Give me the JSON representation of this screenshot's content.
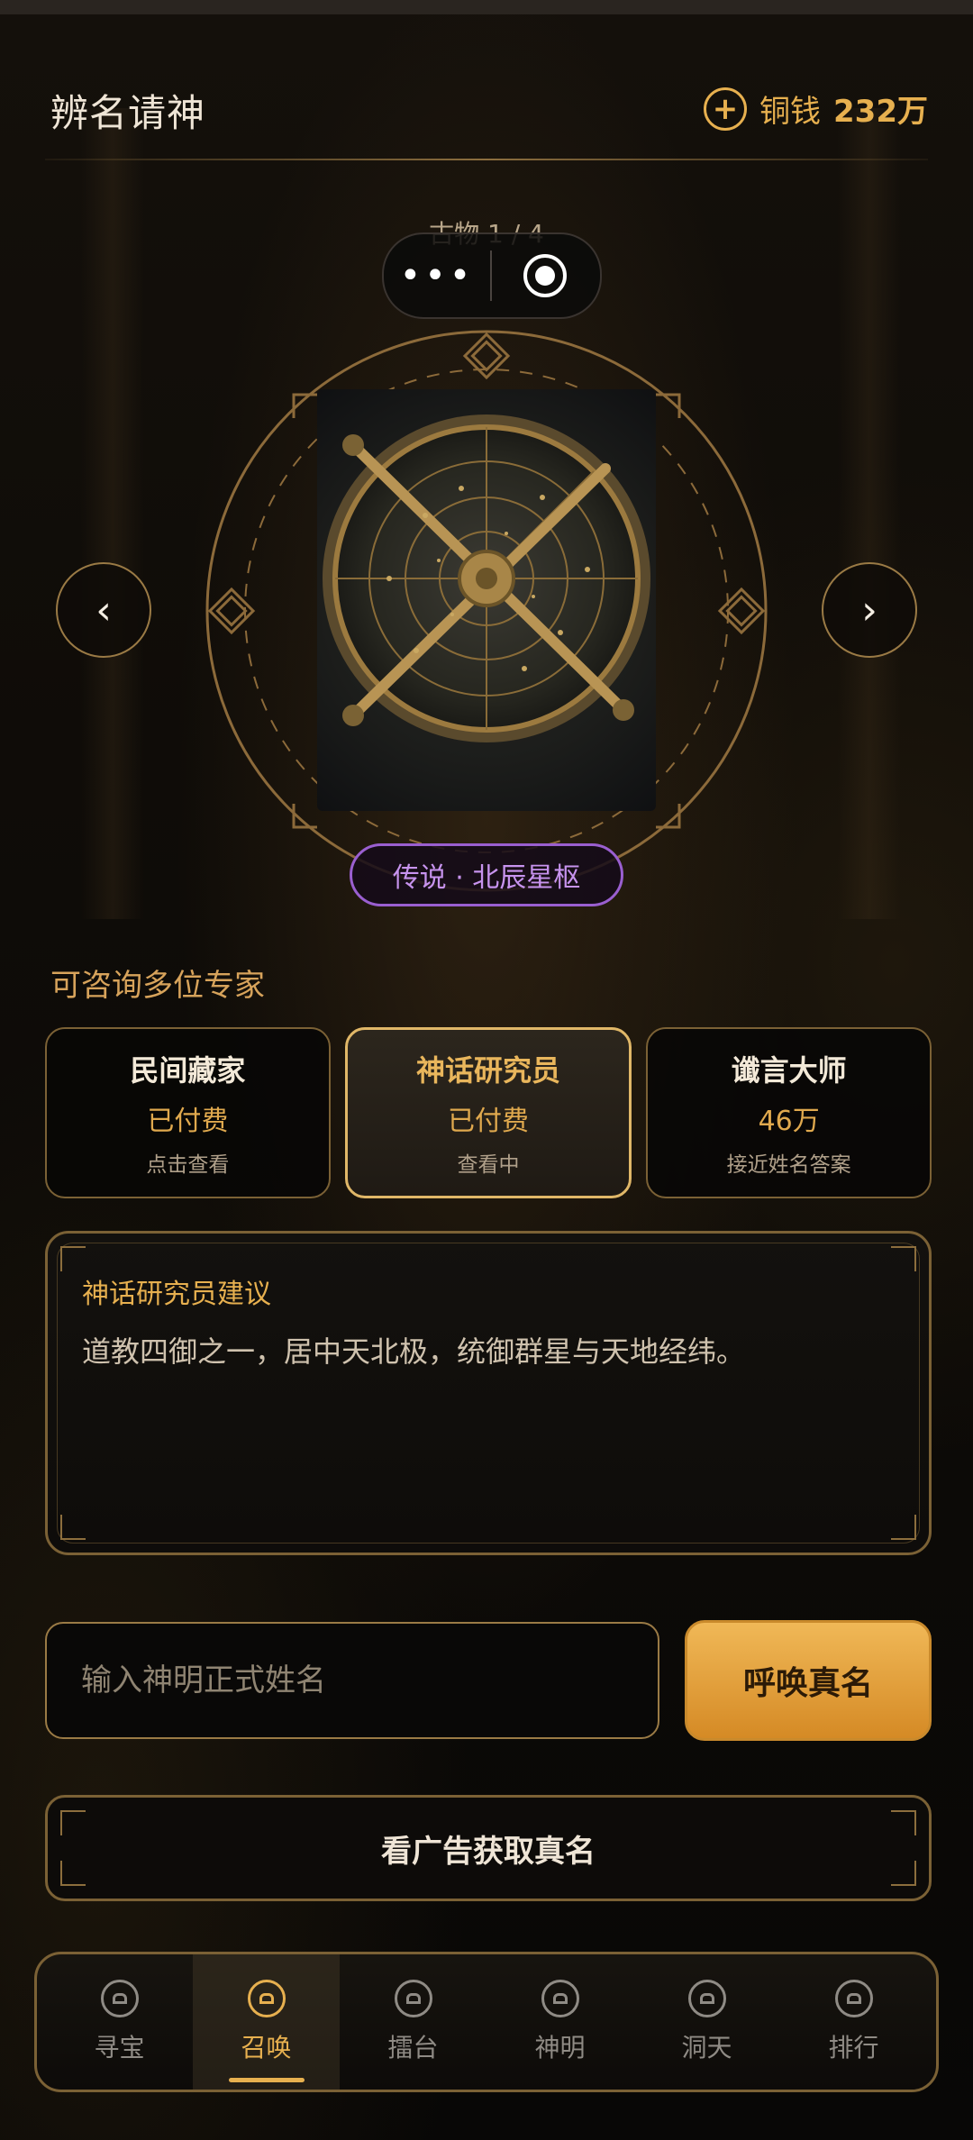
{
  "header": {
    "title": "辨名请神",
    "currency_label": "铜钱",
    "currency_value": "232万"
  },
  "artifact": {
    "counter": "古物 1 / 4",
    "rarity_label": "传说 · 北辰星枢"
  },
  "experts": {
    "section_title": "可咨询多位专家",
    "items": [
      {
        "name": "民间藏家",
        "price": "已付费",
        "hint": "点击查看"
      },
      {
        "name": "神话研究员",
        "price": "已付费",
        "hint": "查看中"
      },
      {
        "name": "谶言大师",
        "price": "46万",
        "hint": "接近姓名答案"
      }
    ]
  },
  "advice": {
    "title": "神话研究员建议",
    "text": "道教四御之一，居中天北极，统御群星与天地经纬。"
  },
  "answer": {
    "placeholder": "输入神明正式姓名",
    "summon_label": "呼唤真名",
    "ad_label": "看广告获取真名"
  },
  "tabs": [
    {
      "label": "寻宝"
    },
    {
      "label": "召唤"
    },
    {
      "label": "擂台"
    },
    {
      "label": "神明"
    },
    {
      "label": "洞天"
    },
    {
      "label": "排行"
    }
  ],
  "colors": {
    "accent": "#e7b04f",
    "rarity": "#9a5fd0",
    "border": "#7b6135"
  }
}
